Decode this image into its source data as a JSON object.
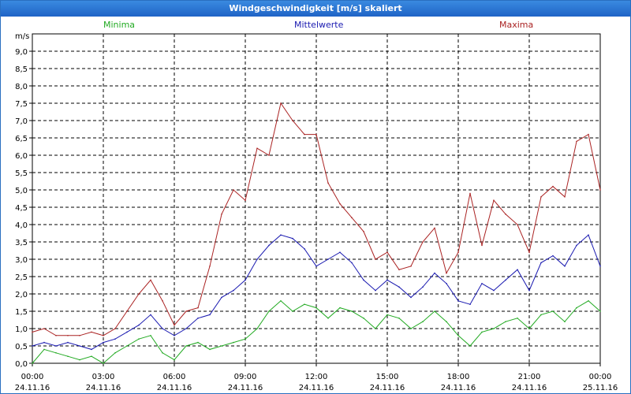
{
  "window": {
    "title": "Windgeschwindigkeit [m/s] skaliert"
  },
  "chart_data": {
    "type": "line",
    "title": "Windgeschwindigkeit [m/s] skaliert",
    "ylabel": "m/s",
    "ylim": [
      0,
      9.5
    ],
    "xlim": [
      0,
      24
    ],
    "yticks": [
      "0,0",
      "0,5",
      "1,0",
      "1,5",
      "2,0",
      "2,5",
      "3,0",
      "3,5",
      "4,0",
      "4,5",
      "5,0",
      "5,5",
      "6,0",
      "6,5",
      "7,0",
      "7,5",
      "8,0",
      "8,5",
      "9,0"
    ],
    "xticks": [
      {
        "time": "00:00",
        "date": "24.11.16"
      },
      {
        "time": "03:00",
        "date": "24.11.16"
      },
      {
        "time": "06:00",
        "date": "24.11.16"
      },
      {
        "time": "09:00",
        "date": "24.11.16"
      },
      {
        "time": "12:00",
        "date": "24.11.16"
      },
      {
        "time": "15:00",
        "date": "24.11.16"
      },
      {
        "time": "18:00",
        "date": "24.11.16"
      },
      {
        "time": "21:00",
        "date": "24.11.16"
      },
      {
        "time": "00:00",
        "date": "25.11.16"
      }
    ],
    "grid": true,
    "legend_position": "top",
    "x": [
      0,
      0.5,
      1,
      1.5,
      2,
      2.5,
      3,
      3.5,
      4,
      4.5,
      5,
      5.5,
      6,
      6.5,
      7,
      7.5,
      8,
      8.5,
      9,
      9.5,
      10,
      10.5,
      11,
      11.5,
      12,
      12.5,
      13,
      13.5,
      14,
      14.5,
      15,
      15.5,
      16,
      16.5,
      17,
      17.5,
      18,
      18.5,
      19,
      19.5,
      20,
      20.5,
      21,
      21.5,
      22,
      22.5,
      23,
      23.5,
      24
    ],
    "series": [
      {
        "name": "Minima",
        "color": "#22aa22",
        "values": [
          0,
          0.4,
          0.3,
          0.2,
          0.1,
          0.2,
          0,
          0.3,
          0.5,
          0.7,
          0.8,
          0.3,
          0.1,
          0.5,
          0.6,
          0.4,
          0.5,
          0.6,
          0.7,
          1.0,
          1.5,
          1.8,
          1.5,
          1.7,
          1.6,
          1.3,
          1.6,
          1.5,
          1.3,
          1.0,
          1.4,
          1.3,
          1.0,
          1.2,
          1.5,
          1.2,
          0.8,
          0.5,
          0.9,
          1.0,
          1.2,
          1.3,
          1.0,
          1.4,
          1.5,
          1.2,
          1.6,
          1.8,
          1.5
        ]
      },
      {
        "name": "Mittelwerte",
        "color": "#1a1ab0",
        "values": [
          0.5,
          0.6,
          0.5,
          0.6,
          0.5,
          0.4,
          0.6,
          0.7,
          0.9,
          1.1,
          1.4,
          1.0,
          0.8,
          1.0,
          1.3,
          1.4,
          1.9,
          2.1,
          2.4,
          3.0,
          3.4,
          3.7,
          3.6,
          3.3,
          2.8,
          3.0,
          3.2,
          2.9,
          2.4,
          2.1,
          2.4,
          2.2,
          1.9,
          2.2,
          2.6,
          2.3,
          1.8,
          1.7,
          2.3,
          2.1,
          2.4,
          2.7,
          2.1,
          2.9,
          3.1,
          2.8,
          3.4,
          3.7,
          2.8
        ]
      },
      {
        "name": "Maxima",
        "color": "#aa2222",
        "values": [
          0.9,
          1.0,
          0.8,
          0.8,
          0.8,
          0.9,
          0.8,
          1.0,
          1.5,
          2.0,
          2.4,
          1.8,
          1.1,
          1.5,
          1.6,
          2.8,
          4.3,
          5.0,
          4.7,
          6.2,
          6.0,
          7.5,
          7.0,
          6.6,
          6.6,
          5.2,
          4.6,
          4.2,
          3.8,
          3.0,
          3.2,
          2.7,
          2.8,
          3.5,
          3.9,
          2.6,
          3.2,
          4.9,
          3.4,
          4.7,
          4.3,
          4.0,
          3.2,
          4.8,
          5.1,
          4.8,
          6.4,
          6.6,
          5.0
        ]
      }
    ]
  }
}
